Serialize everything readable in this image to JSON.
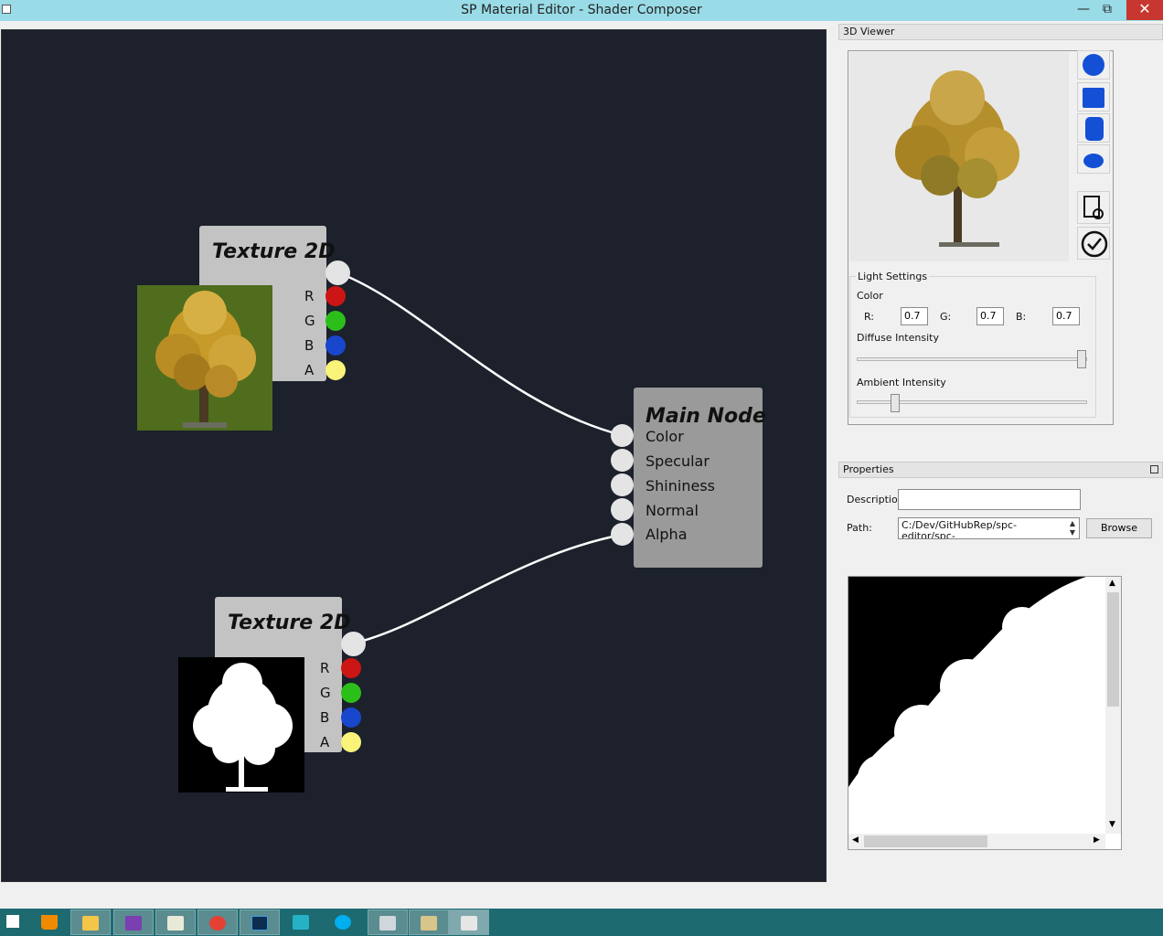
{
  "window": {
    "title": "SP Material Editor - Shader Composer",
    "minimize_label": "—",
    "maximize_label": "⧉",
    "close_label": "✕"
  },
  "graph": {
    "texture_nodes": [
      {
        "title": "Texture 2D",
        "channels": [
          "R",
          "G",
          "B",
          "A"
        ]
      },
      {
        "title": "Texture 2D",
        "channels": [
          "R",
          "G",
          "B",
          "A"
        ]
      }
    ],
    "main_node": {
      "title": "Main Node",
      "inputs": [
        "Color",
        "Specular",
        "Shininess",
        "Normal",
        "Alpha"
      ]
    },
    "colors": {
      "canvas": "#1c212c",
      "port_r": "#cc1515",
      "port_g": "#2cbf1a",
      "port_b": "#1846cc",
      "port_a": "#f9f37a"
    }
  },
  "viewer": {
    "header": "3D Viewer",
    "shapes": [
      "sphere-icon",
      "cube-icon",
      "cylinder-icon",
      "teapot-icon"
    ],
    "actions": [
      "inspect-document-icon",
      "checkmark-icon"
    ],
    "light_settings": {
      "title": "Light Settings",
      "color_label": "Color",
      "r_label": "R:",
      "r_value": "0.7",
      "g_label": "G:",
      "g_value": "0.7",
      "b_label": "B:",
      "b_value": "0.7",
      "diffuse_label": "Diffuse Intensity",
      "ambient_label": "Ambient Intensity"
    }
  },
  "properties": {
    "header": "Properties",
    "description_label": "Description",
    "description_value": "",
    "path_label": "Path:",
    "path_value": "C:/Dev/GitHubRep/spc-editor/spc-editor/Resources/Images/",
    "browse_label": "Browse"
  },
  "taskbar": {
    "items": [
      "windows-start-icon",
      "vlc-icon",
      "file-explorer-icon",
      "visual-studio-icon",
      "notepad-icon",
      "chrome-icon",
      "photoshop-icon",
      "app-icon",
      "skype-icon",
      "calculator-icon",
      "paint-icon",
      "shader-composer-icon"
    ]
  }
}
